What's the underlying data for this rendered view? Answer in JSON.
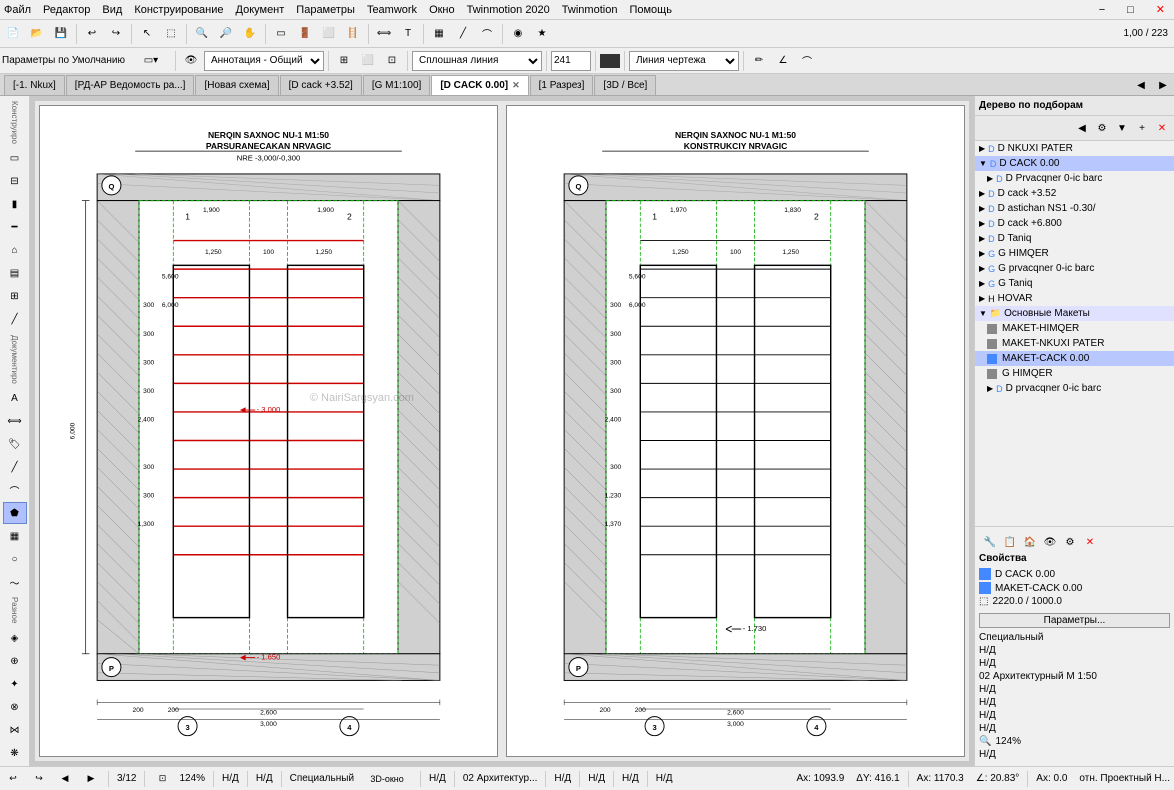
{
  "menubar": {
    "items": [
      "Файл",
      "Редактор",
      "Вид",
      "Конструирование",
      "Документ",
      "Параметры",
      "Teamwork",
      "Окно",
      "Twinmotion 2020",
      "Twinmotion",
      "Помощь"
    ]
  },
  "tabs": [
    {
      "label": "[-1. Nkux]",
      "active": false,
      "closable": false
    },
    {
      "label": "[РД-АР Ведомость ра...]",
      "active": false,
      "closable": false
    },
    {
      "label": "[Новая схема]",
      "active": false,
      "closable": false
    },
    {
      "label": "[D cack +3.52]",
      "active": false,
      "closable": false
    },
    {
      "label": "[G M1:100]",
      "active": false,
      "closable": false
    },
    {
      "label": "[D CACK 0.00]",
      "active": true,
      "closable": true
    },
    {
      "label": "[1 Разрез]",
      "active": false,
      "closable": false
    },
    {
      "label": "[3D / Все]",
      "active": false,
      "closable": false
    }
  ],
  "toolbar2": {
    "annotation_label": "Аннотация - Общий",
    "line_type": "Сплошная линия",
    "scale_value": "241",
    "layer_label": "Линия чертежа"
  },
  "left_drawing": {
    "title_line1": "NERQIN SAXNOC NU-1 M1:50",
    "title_line2": "PARSURANECAKAN NRVAGIC",
    "title_line3": "NRE -3,000/-0,300",
    "dimension_minus3000": "-3.000",
    "dimension_minus1650": "-1.650",
    "dim_200_left": "200",
    "dim_200_left2": "200",
    "dim_1": "1",
    "dim_2": "2",
    "dim_3": "3",
    "dim_4": "4",
    "dim_2600": "2,600",
    "dim_3000": "3,000",
    "dim_1250_l": "1,250",
    "dim_100": "100",
    "dim_1250_r": "1,250",
    "dim_q_label": "Q",
    "dim_p_label": "P"
  },
  "right_drawing": {
    "title_line1": "NERQIN SAXNOC NU-1 M1:50",
    "title_line2": "KONSTRUKCIY NRVAGIC",
    "dimension_minus1730": "-1.730",
    "dim_200_left": "200",
    "dim_200_left2": "200",
    "dim_1": "1",
    "dim_2": "2",
    "dim_3": "3",
    "dim_4": "4",
    "dim_2600": "2,600",
    "dim_3000": "3,000",
    "dim_1250_l": "1,250",
    "dim_100": "100",
    "dim_1250_r": "1,250",
    "dim_q_label": "Q",
    "dim_p_label": "P"
  },
  "tree": {
    "title": "Дерево по подборам",
    "items": [
      {
        "label": "D NKUXI PATER",
        "indent": 1,
        "arrow": "▶",
        "color": "#4488ff"
      },
      {
        "label": "D CACK 0.00",
        "indent": 1,
        "arrow": "▼",
        "color": "#4488ff",
        "selected": true
      },
      {
        "label": "D Prvacqner 0-ic barc",
        "indent": 2,
        "arrow": "▶",
        "color": "#4488ff"
      },
      {
        "label": "D cack +3.52",
        "indent": 1,
        "arrow": "▶",
        "color": "#4488ff"
      },
      {
        "label": "D astichan NS1 -0.30/",
        "indent": 1,
        "arrow": "▶",
        "color": "#4488ff"
      },
      {
        "label": "D cack +6.800",
        "indent": 1,
        "arrow": "▶",
        "color": "#4488ff"
      },
      {
        "label": "D Taniq",
        "indent": 1,
        "arrow": "▶",
        "color": "#4488ff"
      },
      {
        "label": "G HIMQER",
        "indent": 1,
        "arrow": "▶",
        "color": "#4488ff"
      },
      {
        "label": "G prvacqner 0-ic barc",
        "indent": 1,
        "arrow": "▶",
        "color": "#4488ff"
      },
      {
        "label": "G Taniq",
        "indent": 1,
        "arrow": "▶",
        "color": "#4488ff"
      },
      {
        "label": "HOVAR",
        "indent": 1,
        "arrow": "▶",
        "color": "#4488ff"
      },
      {
        "label": "Основные Макеты",
        "indent": 1,
        "arrow": "▼",
        "color": null
      },
      {
        "label": "MAKET-HIMQER",
        "indent": 2,
        "arrow": null,
        "color": "#888"
      },
      {
        "label": "MAKET-NKUXI PATER",
        "indent": 2,
        "arrow": null,
        "color": "#888"
      },
      {
        "label": "MAKET-CACK 0.00",
        "indent": 2,
        "arrow": null,
        "color": "#4488ff"
      },
      {
        "label": "G HIMQER",
        "indent": 2,
        "arrow": null,
        "color": "#888"
      },
      {
        "label": "D prvacqner 0-ic barc",
        "indent": 2,
        "arrow": "▶",
        "color": "#4488ff"
      }
    ]
  },
  "properties": {
    "title": "Свойства",
    "name_label": "D CACK 0.00",
    "maket_label": "MAKET-CACK 0.00",
    "dimensions": "2220.0 / 1000.0",
    "params_button": "Параметры...",
    "special_label": "Специальный",
    "nd1": "Н/Д",
    "nd2": "Н/Д",
    "arch_label": "02 Архитектурный М 1:50",
    "nd3": "Н/Д",
    "nd4": "Н/Д",
    "nd5": "Н/Д",
    "nd6": "Н/Д",
    "zoom": "124%",
    "nd7": "Н/Д"
  },
  "statusbar": {
    "page": "3/12",
    "zoom": "124%",
    "nd1": "Н/Д",
    "nd2": "Н/Д",
    "special": "Специальный",
    "nd3": "Н/Д",
    "arch": "02 Архитектур...",
    "nd4": "Н/Д",
    "nd5": "Н/Д",
    "nd6": "Н/Д",
    "nd7": "Н/Д",
    "ax": "Ax: 1093.9",
    "ay": "ΔY: 416.1",
    "bx": "Ax: 1170.3",
    "bangle": "∠: 20.83°",
    "cx": "Ax: 0.0",
    "cn": "отн. Проектный H..."
  },
  "watermark": "© NairiSargsyan.com",
  "window_controls": {
    "minimize": "−",
    "maximize": "□",
    "close": "✕"
  }
}
